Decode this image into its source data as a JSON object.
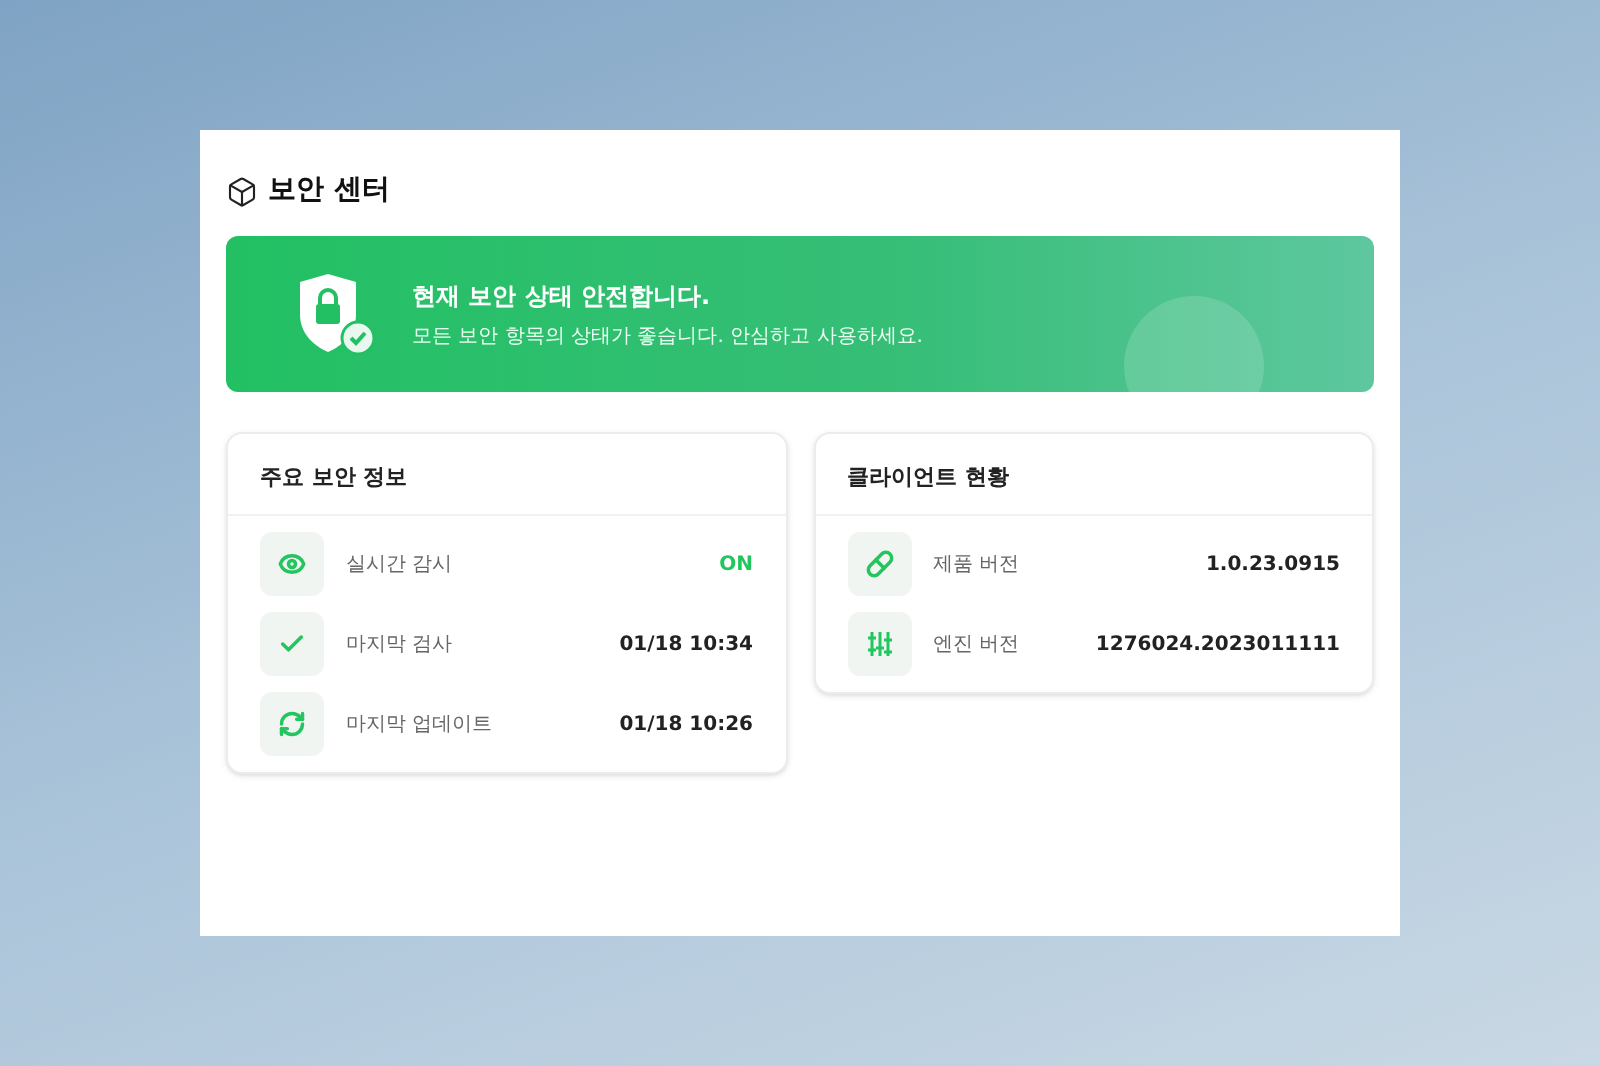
{
  "window": {
    "title": "보안 센터"
  },
  "banner": {
    "title": "현재 보안 상태 안전합니다.",
    "message": "모든 보안 항목의 상태가 좋습니다. 안심하고 사용하세요."
  },
  "security_info": {
    "title": "주요 보안 정보",
    "rows": [
      {
        "label": "실시간 감시",
        "value": "ON",
        "kind": "status"
      },
      {
        "label": "마지막 검사",
        "value": "01/18 10:34",
        "kind": "text"
      },
      {
        "label": "마지막 업데이트",
        "value": "01/18 10:26",
        "kind": "text"
      }
    ]
  },
  "client_status": {
    "title": "클라이언트 현황",
    "rows": [
      {
        "label": "제품 버전",
        "value": "1.0.23.0915"
      },
      {
        "label": "엔진 버전",
        "value": "1276024.2023011111"
      }
    ]
  }
}
